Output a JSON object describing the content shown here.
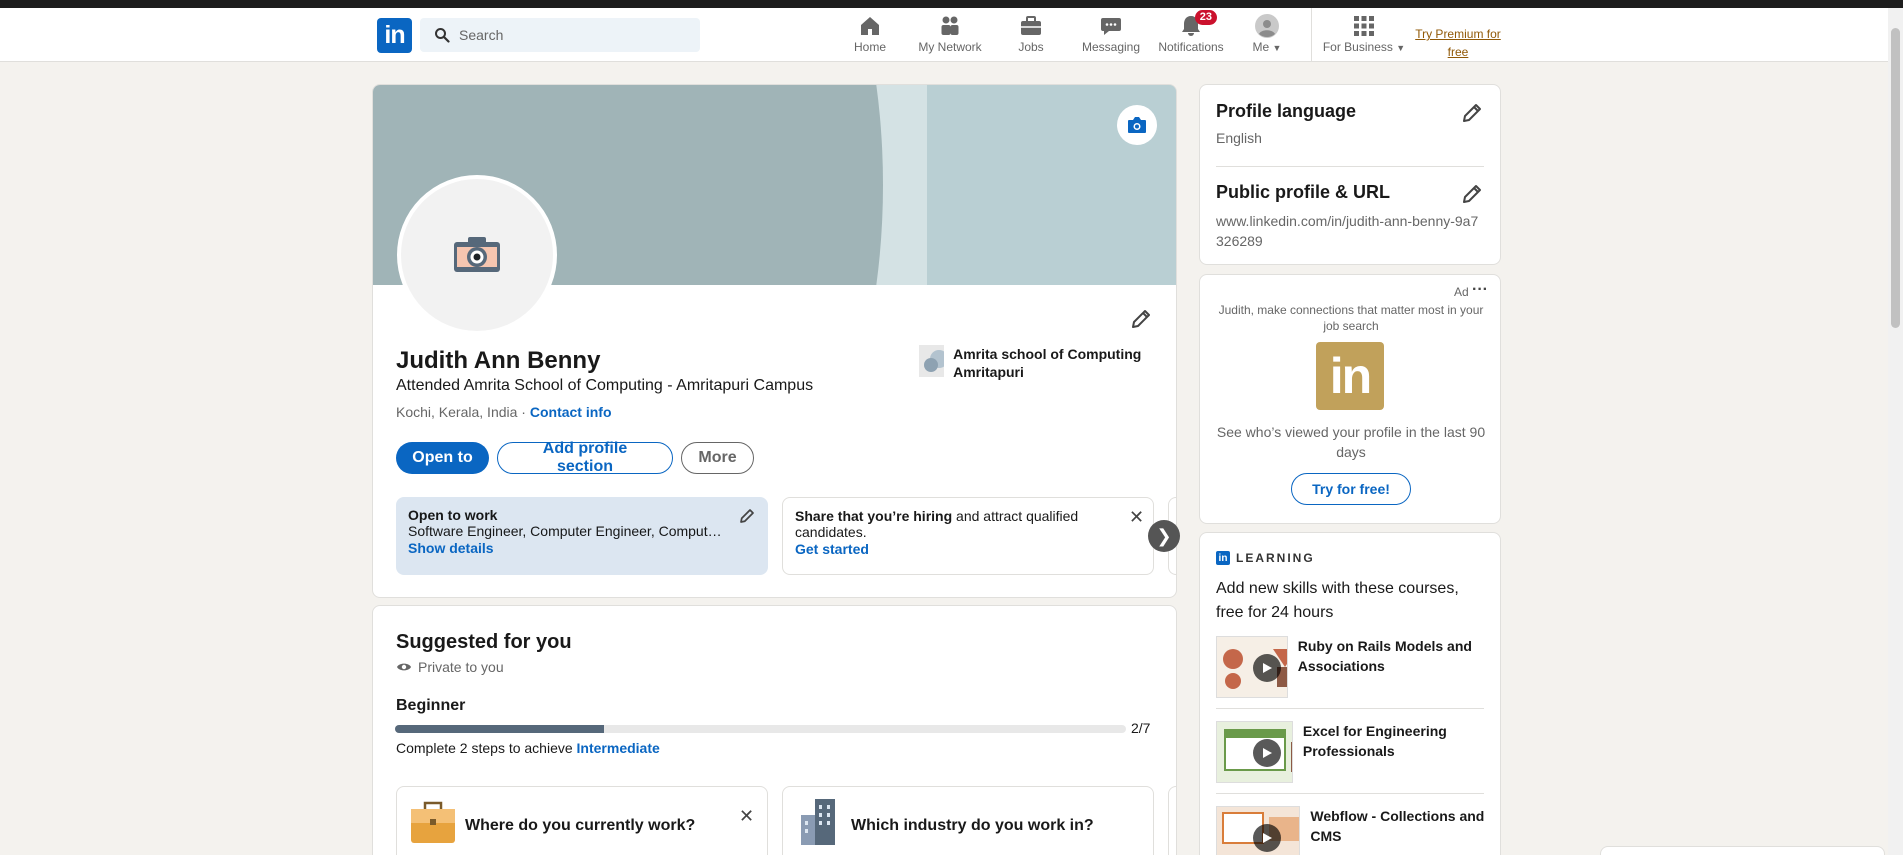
{
  "nav": {
    "logo": "in",
    "search_placeholder": "Search",
    "items": [
      {
        "label": "Home",
        "icon": "home-icon"
      },
      {
        "label": "My Network",
        "icon": "network-icon"
      },
      {
        "label": "Jobs",
        "icon": "briefcase-icon"
      },
      {
        "label": "Messaging",
        "icon": "messaging-icon"
      },
      {
        "label": "Notifications",
        "icon": "bell-icon",
        "badge": "23"
      },
      {
        "label": "Me",
        "icon": "avatar-icon"
      },
      {
        "label": "For Business",
        "icon": "grid-icon"
      }
    ],
    "premium": "Try Premium for free"
  },
  "profile": {
    "name": "Judith Ann Benny",
    "headline": "Attended Amrita School of Computing - Amritapuri Campus",
    "location": "Kochi, Kerala, India",
    "location_sep": " · ",
    "contact": "Contact info",
    "education": "Amrita school of Computing Amritapuri",
    "buttons": {
      "open_to": "Open to",
      "add_section": "Add profile section",
      "more": "More"
    },
    "open_to_work": {
      "title": "Open to work",
      "roles": "Software Engineer, Computer Engineer, Comput…",
      "link": "Show details"
    },
    "hiring": {
      "bold": "Share that you’re hiring",
      "rest": " and attract qualified candidates.",
      "link": "Get started"
    }
  },
  "suggested": {
    "title": "Suggested for you",
    "private": "Private to you",
    "level": "Beginner",
    "progress_text": "2/7",
    "progress_value": 0.2857,
    "complete_text": "Complete 2 steps to achieve ",
    "next_level": "Intermediate",
    "cards": [
      {
        "title": "Where do you currently work?"
      },
      {
        "title": "Which industry do you work in?"
      }
    ]
  },
  "sidebar": {
    "language": {
      "title": "Profile language",
      "value": "English"
    },
    "public_url": {
      "title": "Public profile & URL",
      "value": "www.linkedin.com/in/judith-ann-benny-9a7326289"
    },
    "ad": {
      "label": "Ad",
      "text": "Judith, make connections that matter most in your job search",
      "logo": "in",
      "body": "See who’s viewed your profile in the last 90 days",
      "cta": "Try for free!"
    },
    "learning": {
      "label": "LEARNING",
      "title": "Add new skills with these courses, free for 24 hours",
      "courses": [
        {
          "title": "Ruby on Rails Models and Associations"
        },
        {
          "title": "Excel for Engineering Professionals"
        },
        {
          "title": "Webflow - Collections and CMS"
        }
      ]
    }
  },
  "colors": {
    "brand": "#0a66c2",
    "premium": "#915907",
    "badge": "#cb112d",
    "background": "#f4f2ee"
  }
}
